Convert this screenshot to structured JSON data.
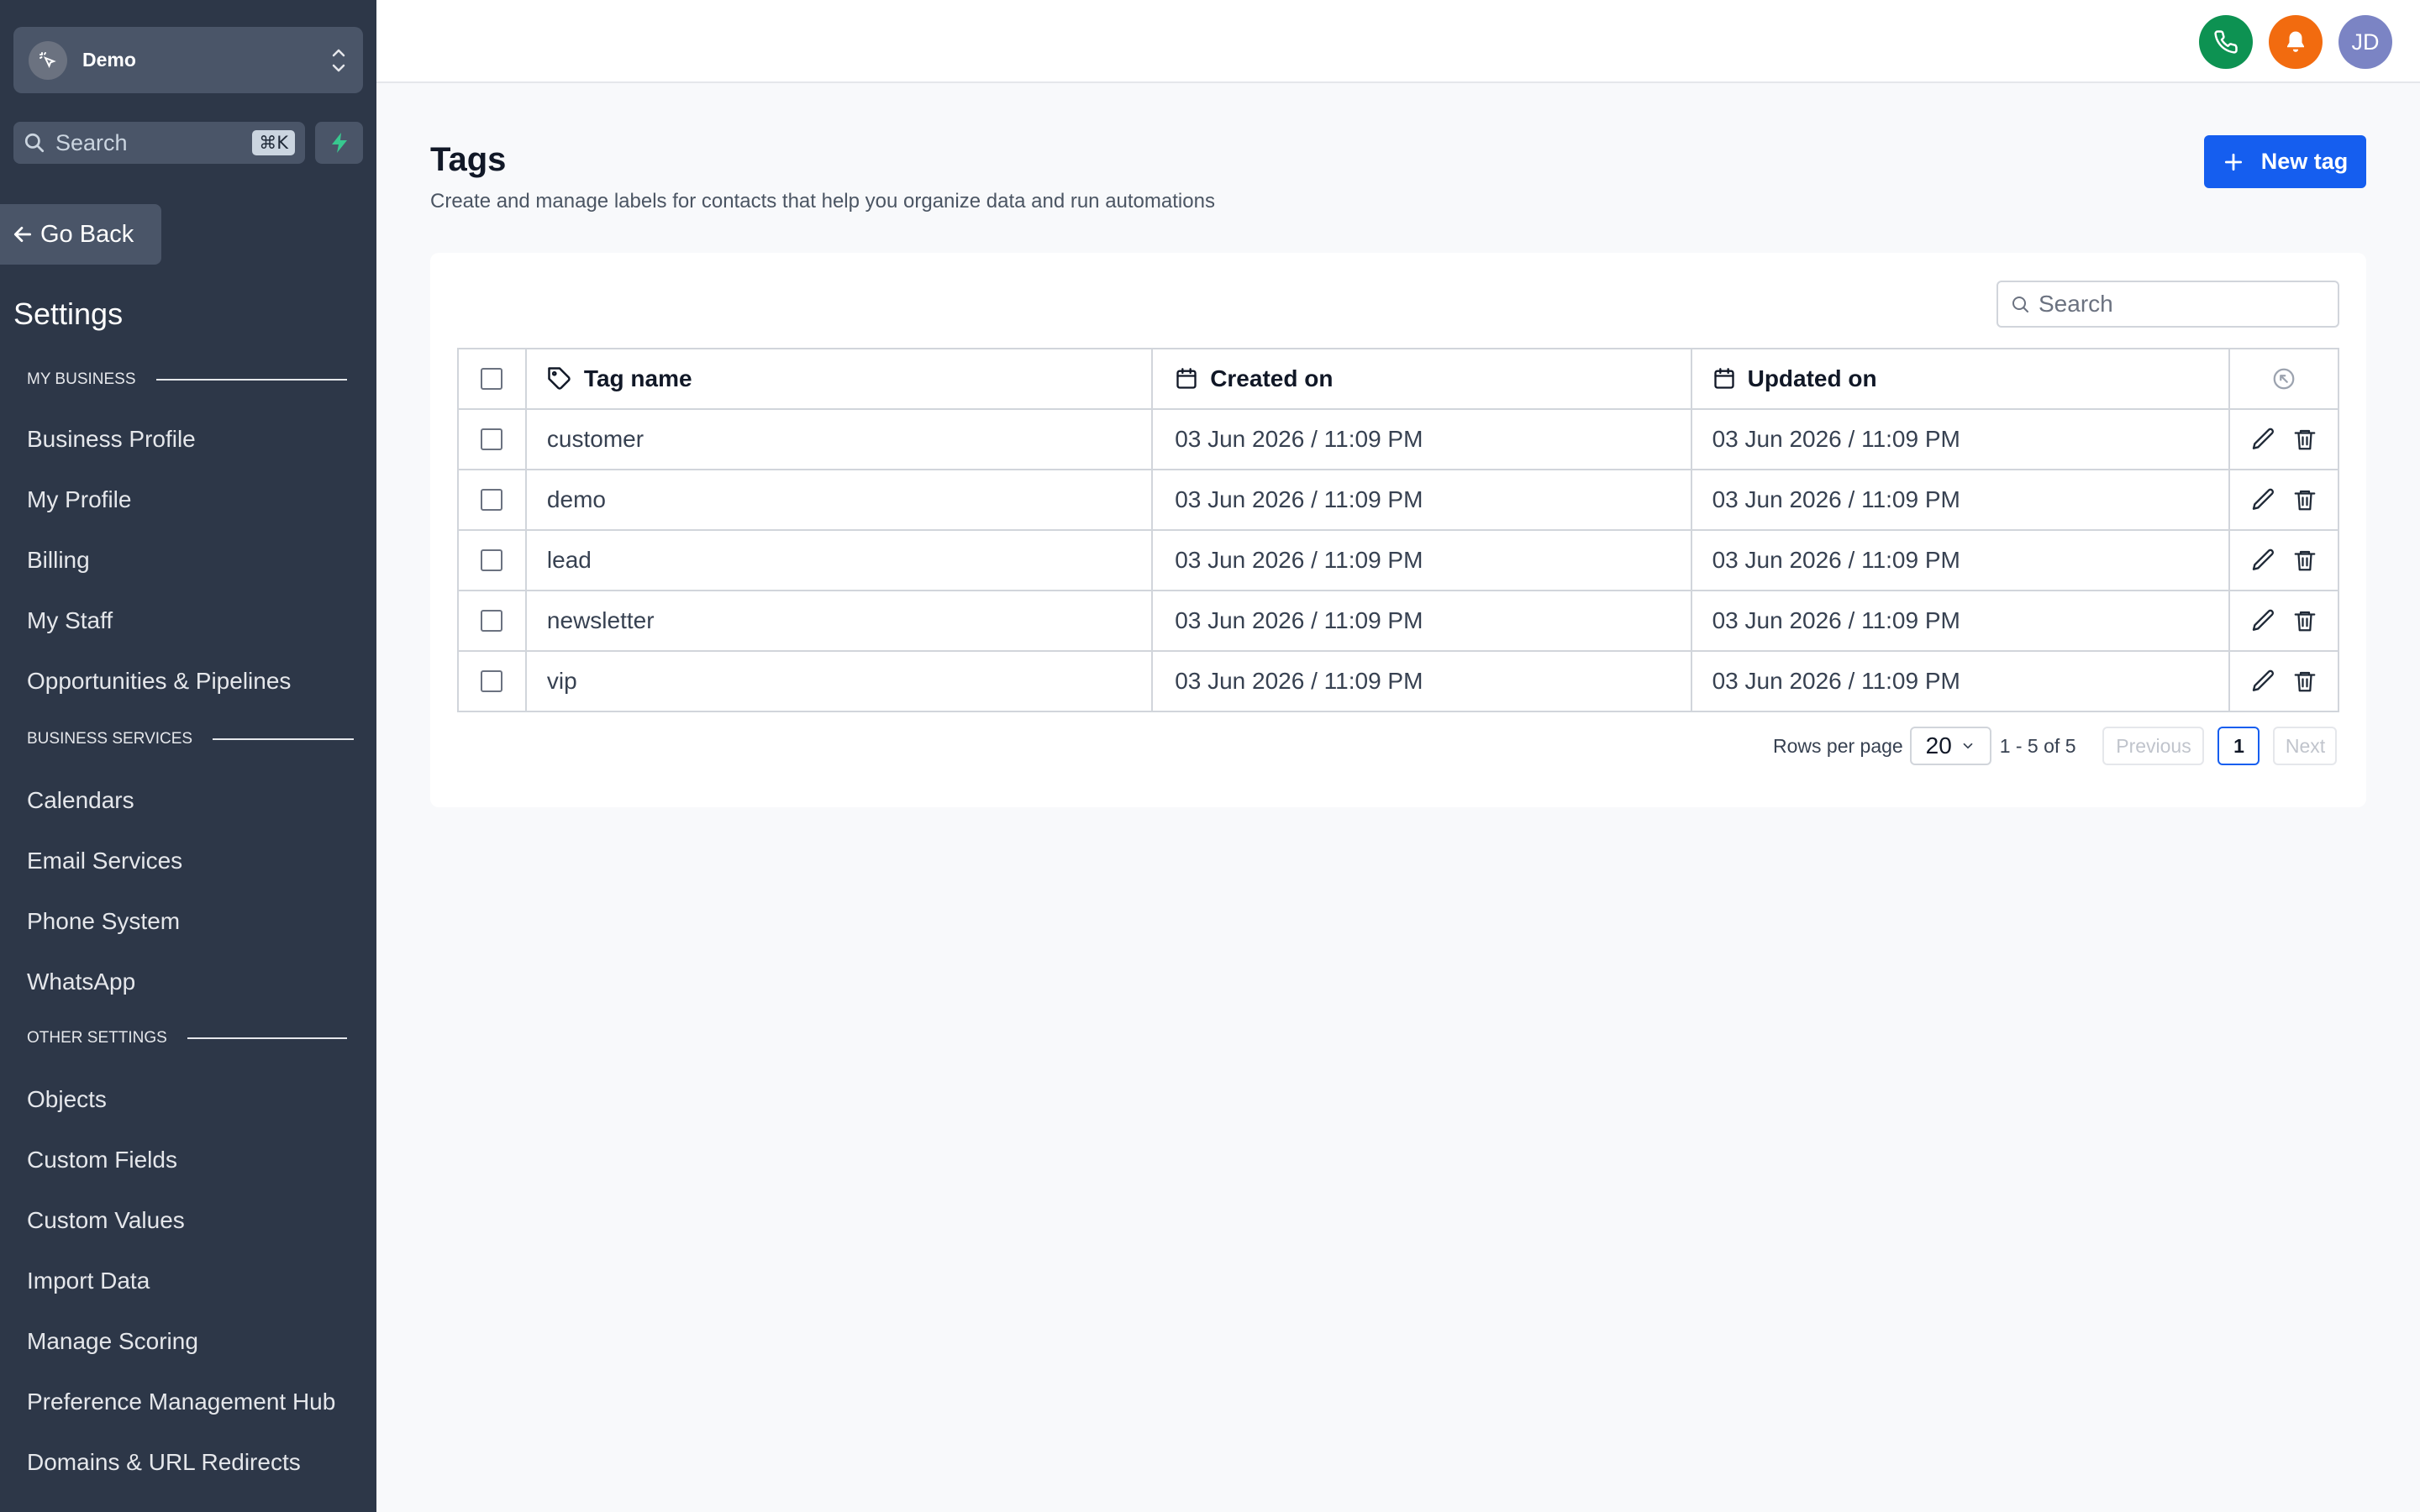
{
  "sidebar": {
    "location_name": "Demo",
    "search_placeholder": "Search",
    "search_shortcut": "⌘K",
    "go_back": "Go Back",
    "settings_title": "Settings",
    "sections": [
      {
        "label": "MY BUSINESS",
        "items": [
          "Business Profile",
          "My Profile",
          "Billing",
          "My Staff",
          "Opportunities & Pipelines"
        ]
      },
      {
        "label": "BUSINESS SERVICES",
        "items": [
          "Calendars",
          "Email Services",
          "Phone System",
          "WhatsApp"
        ]
      },
      {
        "label": "OTHER SETTINGS",
        "items": [
          "Objects",
          "Custom Fields",
          "Custom Values",
          "Import Data",
          "Manage Scoring",
          "Preference Management Hub",
          "Domains & URL Redirects"
        ]
      }
    ]
  },
  "topbar": {
    "avatar_initials": "JD",
    "phone_color": "#0d9252",
    "bell_color": "#f26b0f",
    "avatar_color": "#7b84c4"
  },
  "page": {
    "title": "Tags",
    "subtitle": "Create and manage labels for contacts that help you organize data and run automations",
    "new_button": "New tag"
  },
  "table": {
    "search_placeholder": "Search",
    "columns": {
      "name": "Tag name",
      "created": "Created on",
      "updated": "Updated on"
    },
    "rows": [
      {
        "name": "customer",
        "created": "03 Jun 2026 / 11:09 PM",
        "updated": "03 Jun 2026 / 11:09 PM"
      },
      {
        "name": "demo",
        "created": "03 Jun 2026 / 11:09 PM",
        "updated": "03 Jun 2026 / 11:09 PM"
      },
      {
        "name": "lead",
        "created": "03 Jun 2026 / 11:09 PM",
        "updated": "03 Jun 2026 / 11:09 PM"
      },
      {
        "name": "newsletter",
        "created": "03 Jun 2026 / 11:09 PM",
        "updated": "03 Jun 2026 / 11:09 PM"
      },
      {
        "name": "vip",
        "created": "03 Jun 2026 / 11:09 PM",
        "updated": "03 Jun 2026 / 11:09 PM"
      }
    ]
  },
  "pagination": {
    "rows_per_page_label": "Rows per page",
    "rows_per_page": "20",
    "range": "1 - 5 of 5",
    "previous": "Previous",
    "current_page": "1",
    "next": "Next"
  }
}
